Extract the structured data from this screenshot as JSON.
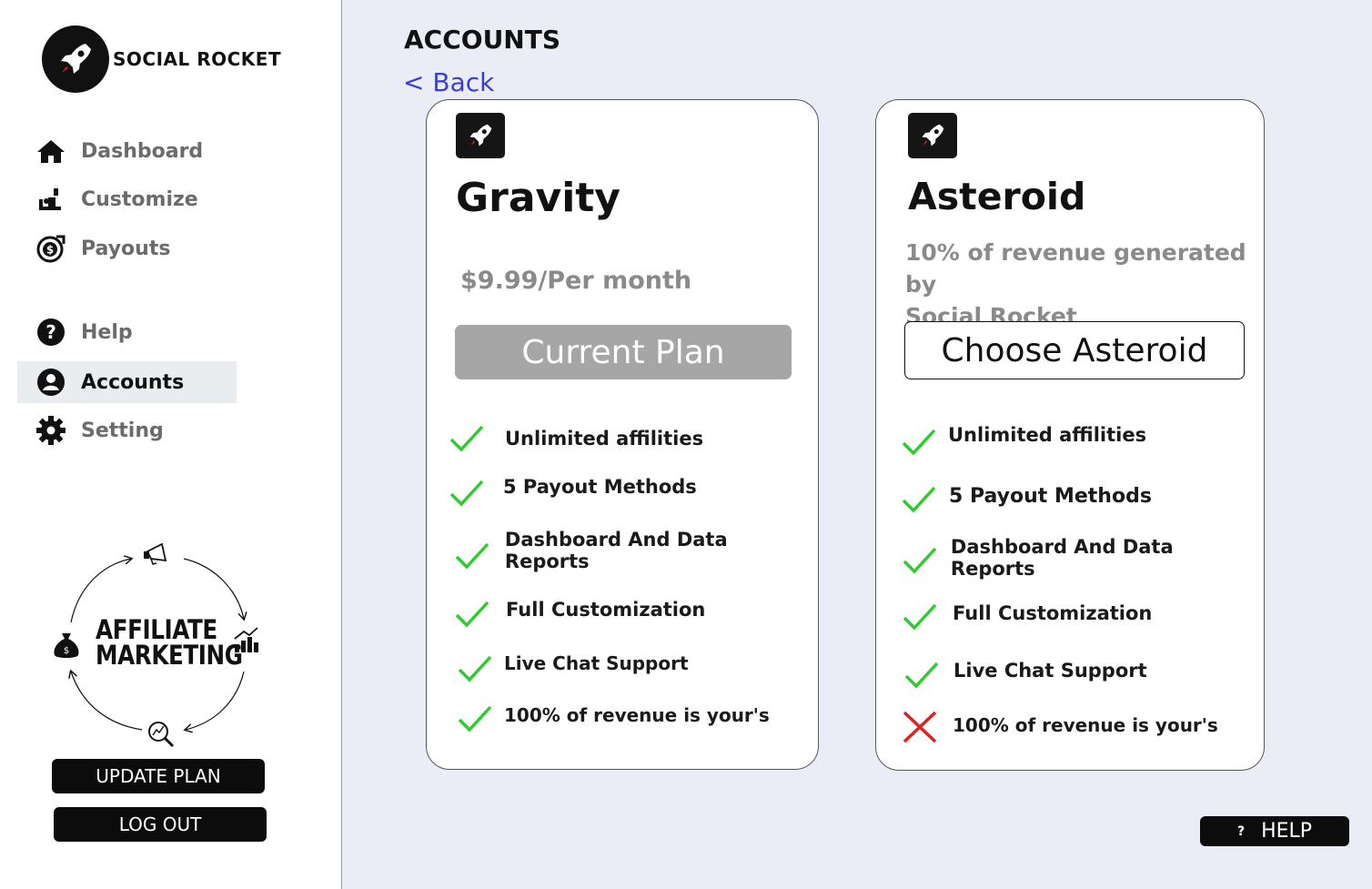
{
  "brand": {
    "name": "SOCIAL ROCKET",
    "icon": "rocket-icon"
  },
  "nav": [
    {
      "label": "Dashboard",
      "icon": "home-icon",
      "active": false
    },
    {
      "label": "Customize",
      "icon": "customize-icon",
      "active": false
    },
    {
      "label": "Payouts",
      "icon": "payouts-icon",
      "active": false
    },
    {
      "label": "Help",
      "icon": "question-icon",
      "active": false
    },
    {
      "label": "Accounts",
      "icon": "user-icon",
      "active": true
    },
    {
      "label": "Setting",
      "icon": "gear-icon",
      "active": false
    }
  ],
  "affiliate": {
    "line1": "AFFILIATE",
    "line2": "MARKETING"
  },
  "buttons": {
    "update_plan": "UPDATE PLAN",
    "log_out": "LOG OUT",
    "help": "HELP",
    "help_icon": "?"
  },
  "page": {
    "title": "ACCOUNTS",
    "back": "< Back"
  },
  "plans": [
    {
      "name": "Gravity",
      "description": "$9.99/Per month",
      "button": "Current Plan",
      "current": true,
      "features": [
        {
          "label": "Unlimited affilities",
          "included": true
        },
        {
          "label": "5 Payout Methods",
          "included": true
        },
        {
          "label": "Dashboard And Data Reports",
          "included": true
        },
        {
          "label": "Full Customization",
          "included": true
        },
        {
          "label": "Live Chat Support",
          "included": true
        },
        {
          "label": "100% of revenue is your's",
          "included": true
        }
      ]
    },
    {
      "name": "Asteroid",
      "description_line1": "10% of revenue generated by",
      "description_line2": "Social Rocket",
      "button": "Choose Asteroid",
      "current": false,
      "features": [
        {
          "label": "Unlimited affilities",
          "included": true
        },
        {
          "label": "5 Payout Methods",
          "included": true
        },
        {
          "label": "Dashboard And Data Reports",
          "included": true
        },
        {
          "label": "Full Customization",
          "included": true
        },
        {
          "label": "Live Chat Support",
          "included": true
        },
        {
          "label": "100% of revenue is your's",
          "included": false
        }
      ]
    }
  ],
  "colors": {
    "check": "#2ecc2e",
    "cross": "#e02020",
    "link": "#3a3fcf",
    "current_button": "#a6a6a6"
  }
}
